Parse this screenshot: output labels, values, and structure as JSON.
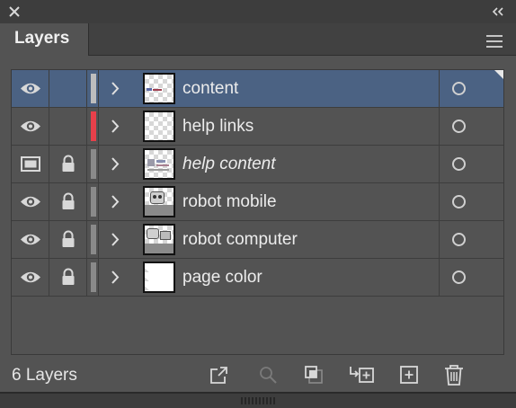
{
  "panel": {
    "tab_label": "Layers",
    "layer_count_label": "6 Layers"
  },
  "layers": [
    {
      "name": "content",
      "visibility": "eye",
      "locked": false,
      "color": "#bdbdbd",
      "italic": false,
      "selected": true
    },
    {
      "name": "help links",
      "visibility": "eye",
      "locked": false,
      "color": "#e8404a",
      "italic": false,
      "selected": false
    },
    {
      "name": "help content",
      "visibility": "template",
      "locked": true,
      "color": "#8a8a8a",
      "italic": true,
      "selected": false
    },
    {
      "name": "robot mobile",
      "visibility": "eye",
      "locked": true,
      "color": "#8a8a8a",
      "italic": false,
      "selected": false
    },
    {
      "name": "robot computer",
      "visibility": "eye",
      "locked": true,
      "color": "#8a8a8a",
      "italic": false,
      "selected": false
    },
    {
      "name": "page color",
      "visibility": "eye",
      "locked": true,
      "color": "#8a8a8a",
      "italic": false,
      "selected": false
    }
  ],
  "icons": {
    "close": "close-icon",
    "collapse": "double-chevron-left-icon",
    "menu": "hamburger-menu-icon",
    "export": "export-icon",
    "search": "search-icon",
    "clipping_mask": "clipping-mask-icon",
    "move_to_layer": "move-to-layer-icon",
    "new_layer": "new-layer-icon",
    "delete": "trash-icon"
  },
  "colors": {
    "panel_bg": "#535353",
    "selected_row": "#4b6283",
    "accent_red": "#e8404a"
  }
}
